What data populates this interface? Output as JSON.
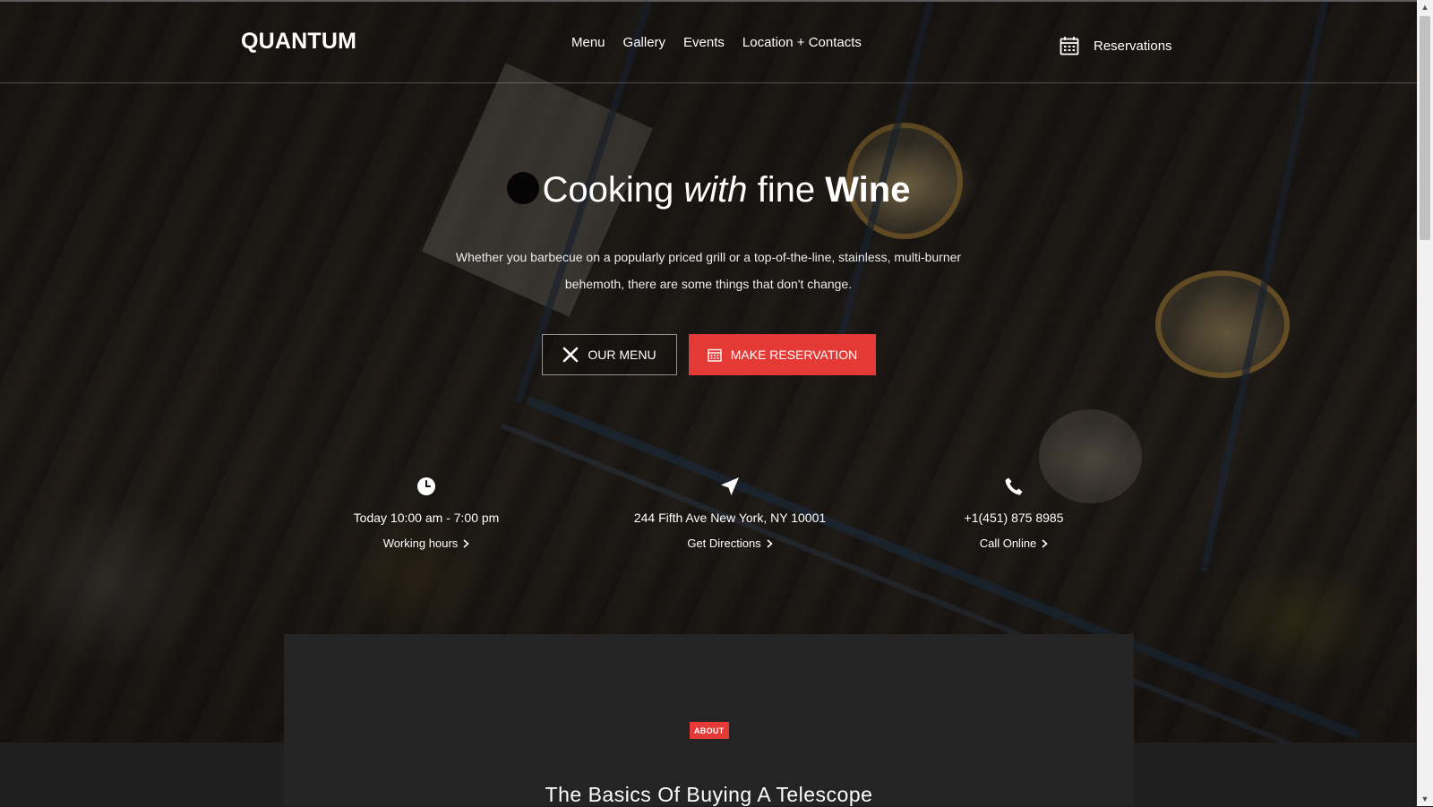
{
  "brand": {
    "logo": "QUANTUM"
  },
  "nav": {
    "items": [
      "Menu",
      "Gallery",
      "Events",
      "Location + Contacts"
    ],
    "reservations_label": "Reservations"
  },
  "hero": {
    "headline": {
      "part1": "Cooking",
      "part2": "with",
      "part3": "fine",
      "part4": "Wine"
    },
    "lead": "Whether you barbecue on a popularly priced grill or a top-of-the-line, stainless, multi-burner behemoth, there are some things that don't change.",
    "buttons": {
      "menu_label": "OUR MENU",
      "reservation_label": "MAKE RESERVATION"
    }
  },
  "info": {
    "hours": {
      "text": "Today 10:00 am - 7:00 pm",
      "link": "Working hours"
    },
    "address": {
      "text": "244 Fifth Ave New York, NY 10001",
      "link": "Get Directions"
    },
    "phone": {
      "text": "+1(451) 875 8985",
      "link": "Call Online"
    }
  },
  "about": {
    "badge": "ABOUT",
    "title": "The Basics Of Buying A Telescope"
  },
  "colors": {
    "accent": "#e53935",
    "background_dark": "#242424"
  },
  "icons": {
    "reservations": "calendar-icon",
    "menu_button": "cutlery-icon",
    "reservation_button": "calendar-icon",
    "hours": "clock-icon",
    "address": "navigation-arrow-icon",
    "phone": "phone-icon",
    "link_arrow": "chevron-right-icon"
  }
}
